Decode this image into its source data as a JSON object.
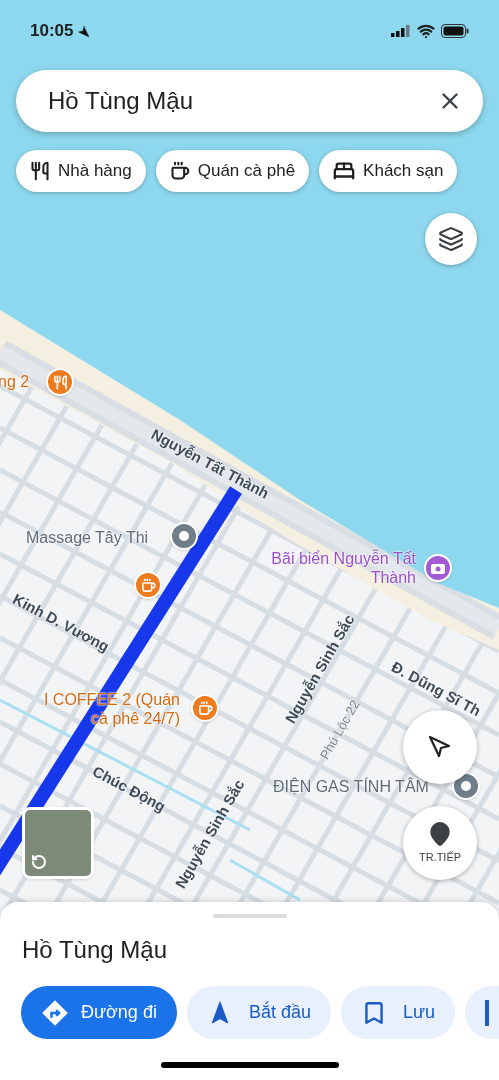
{
  "status_bar": {
    "time": "10:05"
  },
  "search": {
    "value": "Hồ Tùng Mậu"
  },
  "chips": [
    {
      "label": "Nhà hàng",
      "kind": "restaurant"
    },
    {
      "label": "Quán cà phê",
      "kind": "cafe"
    },
    {
      "label": "Khách sạn",
      "kind": "hotel"
    }
  ],
  "map": {
    "labels": [
      {
        "text": "ng 2",
        "kind": "poi",
        "color": "#d4690f"
      },
      {
        "text": "Nguyễn Tất Thành",
        "kind": "street"
      },
      {
        "text": "Massage Tây Thi",
        "kind": "poi",
        "color": "#5f6b75"
      },
      {
        "text": "Bãi biển Nguyễn Tất Thành",
        "kind": "poi",
        "color": "#9a4fc8"
      },
      {
        "text": "Kinh D. Vương",
        "kind": "street"
      },
      {
        "text": "I COFFEE 2 (Quán cà phê 24/7)",
        "kind": "poi",
        "color": "#d4690f"
      },
      {
        "text": "Nguyễn Sinh Sắc",
        "kind": "street"
      },
      {
        "text": "Phú Lộc 22",
        "kind": "lane"
      },
      {
        "text": "Đ. Dũng Sĩ Th",
        "kind": "street"
      },
      {
        "text": "Chúc Động",
        "kind": "street"
      },
      {
        "text": "ĐIỆN GAS TÍNH TÂM",
        "kind": "poi",
        "color": "#5f6b75"
      },
      {
        "text": "Nguyễn Sinh Sắc",
        "kind": "street"
      }
    ],
    "live_view_label": "TR.TIẾP"
  },
  "place_sheet": {
    "title": "Hồ Tùng Mậu",
    "actions": [
      {
        "label": "Đường đi",
        "kind": "directions"
      },
      {
        "label": "Bắt đầu",
        "kind": "start"
      },
      {
        "label": "Lưu",
        "kind": "save"
      }
    ]
  }
}
